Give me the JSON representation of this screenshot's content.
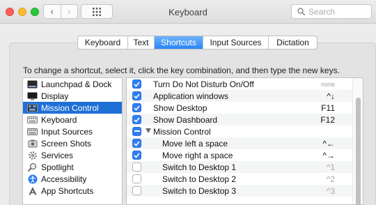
{
  "window": {
    "title": "Keyboard",
    "search_placeholder": "Search"
  },
  "nav": {
    "back": "‹",
    "forward": "›"
  },
  "tabs": [
    {
      "label": "Keyboard",
      "active": false
    },
    {
      "label": "Text",
      "active": false
    },
    {
      "label": "Shortcuts",
      "active": true
    },
    {
      "label": "Input Sources",
      "active": false
    },
    {
      "label": "Dictation",
      "active": false
    }
  ],
  "instructions": "To change a shortcut, select it, click the key combination, and then type the new keys.",
  "categories": [
    {
      "label": "Launchpad & Dock",
      "icon": "launchpad-icon",
      "selected": false
    },
    {
      "label": "Display",
      "icon": "display-icon",
      "selected": false
    },
    {
      "label": "Mission Control",
      "icon": "mission-control-icon",
      "selected": true
    },
    {
      "label": "Keyboard",
      "icon": "keyboard-icon",
      "selected": false
    },
    {
      "label": "Input Sources",
      "icon": "input-sources-icon",
      "selected": false
    },
    {
      "label": "Screen Shots",
      "icon": "screenshot-icon",
      "selected": false
    },
    {
      "label": "Services",
      "icon": "gear-icon",
      "selected": false
    },
    {
      "label": "Spotlight",
      "icon": "spotlight-icon",
      "selected": false
    },
    {
      "label": "Accessibility",
      "icon": "accessibility-icon",
      "selected": false
    },
    {
      "label": "App Shortcuts",
      "icon": "app-shortcuts-icon",
      "selected": false
    }
  ],
  "shortcuts": [
    {
      "label": "Turn Do Not Disturb On/Off",
      "key": "none",
      "state": "on",
      "indent": 0,
      "keystyle": "tiny"
    },
    {
      "label": "Application windows",
      "key": "^↓",
      "state": "on",
      "indent": 0,
      "keystyle": "normal"
    },
    {
      "label": "Show Desktop",
      "key": "F11",
      "state": "on",
      "indent": 0,
      "keystyle": "normal"
    },
    {
      "label": "Show Dashboard",
      "key": "F12",
      "state": "on",
      "indent": 0,
      "keystyle": "normal"
    },
    {
      "label": "Mission Control",
      "key": "",
      "state": "mixed",
      "indent": 0,
      "keystyle": "normal",
      "group": true
    },
    {
      "label": "Move left a space",
      "key": "^←",
      "state": "on",
      "indent": 1,
      "keystyle": "normal"
    },
    {
      "label": "Move right a space",
      "key": "^→",
      "state": "on",
      "indent": 1,
      "keystyle": "normal"
    },
    {
      "label": "Switch to Desktop 1",
      "key": "^1",
      "state": "off",
      "indent": 1,
      "keystyle": "dim"
    },
    {
      "label": "Switch to Desktop 2",
      "key": "^2",
      "state": "off",
      "indent": 1,
      "keystyle": "dim"
    },
    {
      "label": "Switch to Desktop 3",
      "key": "^3",
      "state": "off",
      "indent": 1,
      "keystyle": "dim"
    }
  ],
  "colors": {
    "accent": "#2f7df6",
    "selection": "#1f70d6"
  }
}
